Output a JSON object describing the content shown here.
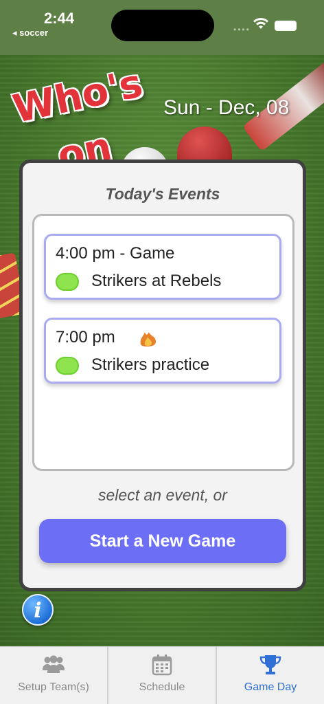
{
  "status_bar": {
    "time": "2:44",
    "back_app": "◂ soccer"
  },
  "header": {
    "logo_line1": "Who's",
    "logo_line2": "on",
    "date": "Sun - Dec, 08"
  },
  "events_card": {
    "title": "Today's Events",
    "events": [
      {
        "time": "4:00 pm - Game",
        "team": "Strikers at Rebels",
        "dot_color": "#8ee44f"
      },
      {
        "time": "7:00 pm",
        "team": "Strikers practice",
        "dot_color": "#8ee44f",
        "icon": "fire-icon"
      }
    ],
    "hint": "select an event, or",
    "new_game_label": "Start a New Game"
  },
  "tabs": [
    {
      "label": "Setup Team(s)",
      "icon": "people-icon",
      "active": false
    },
    {
      "label": "Schedule",
      "icon": "calendar-icon",
      "active": false
    },
    {
      "label": "Game Day",
      "icon": "trophy-icon",
      "active": true
    }
  ],
  "colors": {
    "accent": "#6c6ef5",
    "active_tab": "#2f6fd6",
    "logo_red": "#e2333b"
  }
}
